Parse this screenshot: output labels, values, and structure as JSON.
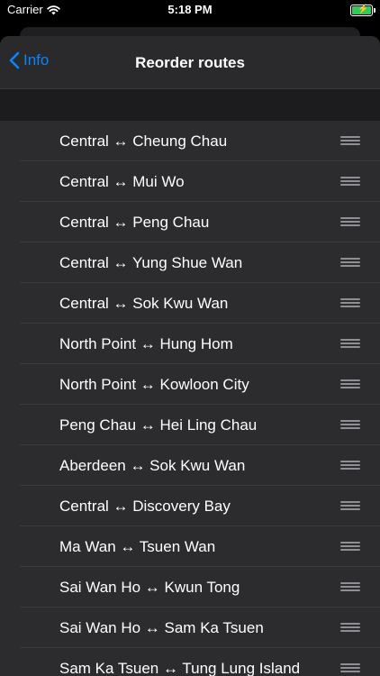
{
  "status": {
    "carrier": "Carrier",
    "time": "5:18 PM"
  },
  "nav": {
    "back_label": "Info",
    "title": "Reorder routes"
  },
  "routes": [
    "Central ↔ Cheung Chau",
    "Central ↔ Mui Wo",
    "Central ↔ Peng Chau",
    "Central ↔ Yung Shue Wan",
    "Central ↔ Sok Kwu Wan",
    "North Point ↔ Hung Hom",
    "North Point ↔ Kowloon City",
    "Peng Chau ↔ Hei Ling Chau",
    "Aberdeen ↔ Sok Kwu Wan",
    "Central ↔ Discovery Bay",
    "Ma Wan ↔ Tsuen Wan",
    "Sai Wan Ho ↔ Kwun Tong",
    "Sai Wan Ho ↔ Sam Ka Tsuen",
    "Sam Ka Tsuen ↔ Tung Lung Island"
  ],
  "colors": {
    "accent": "#0a84ff",
    "battery": "#34c759"
  }
}
